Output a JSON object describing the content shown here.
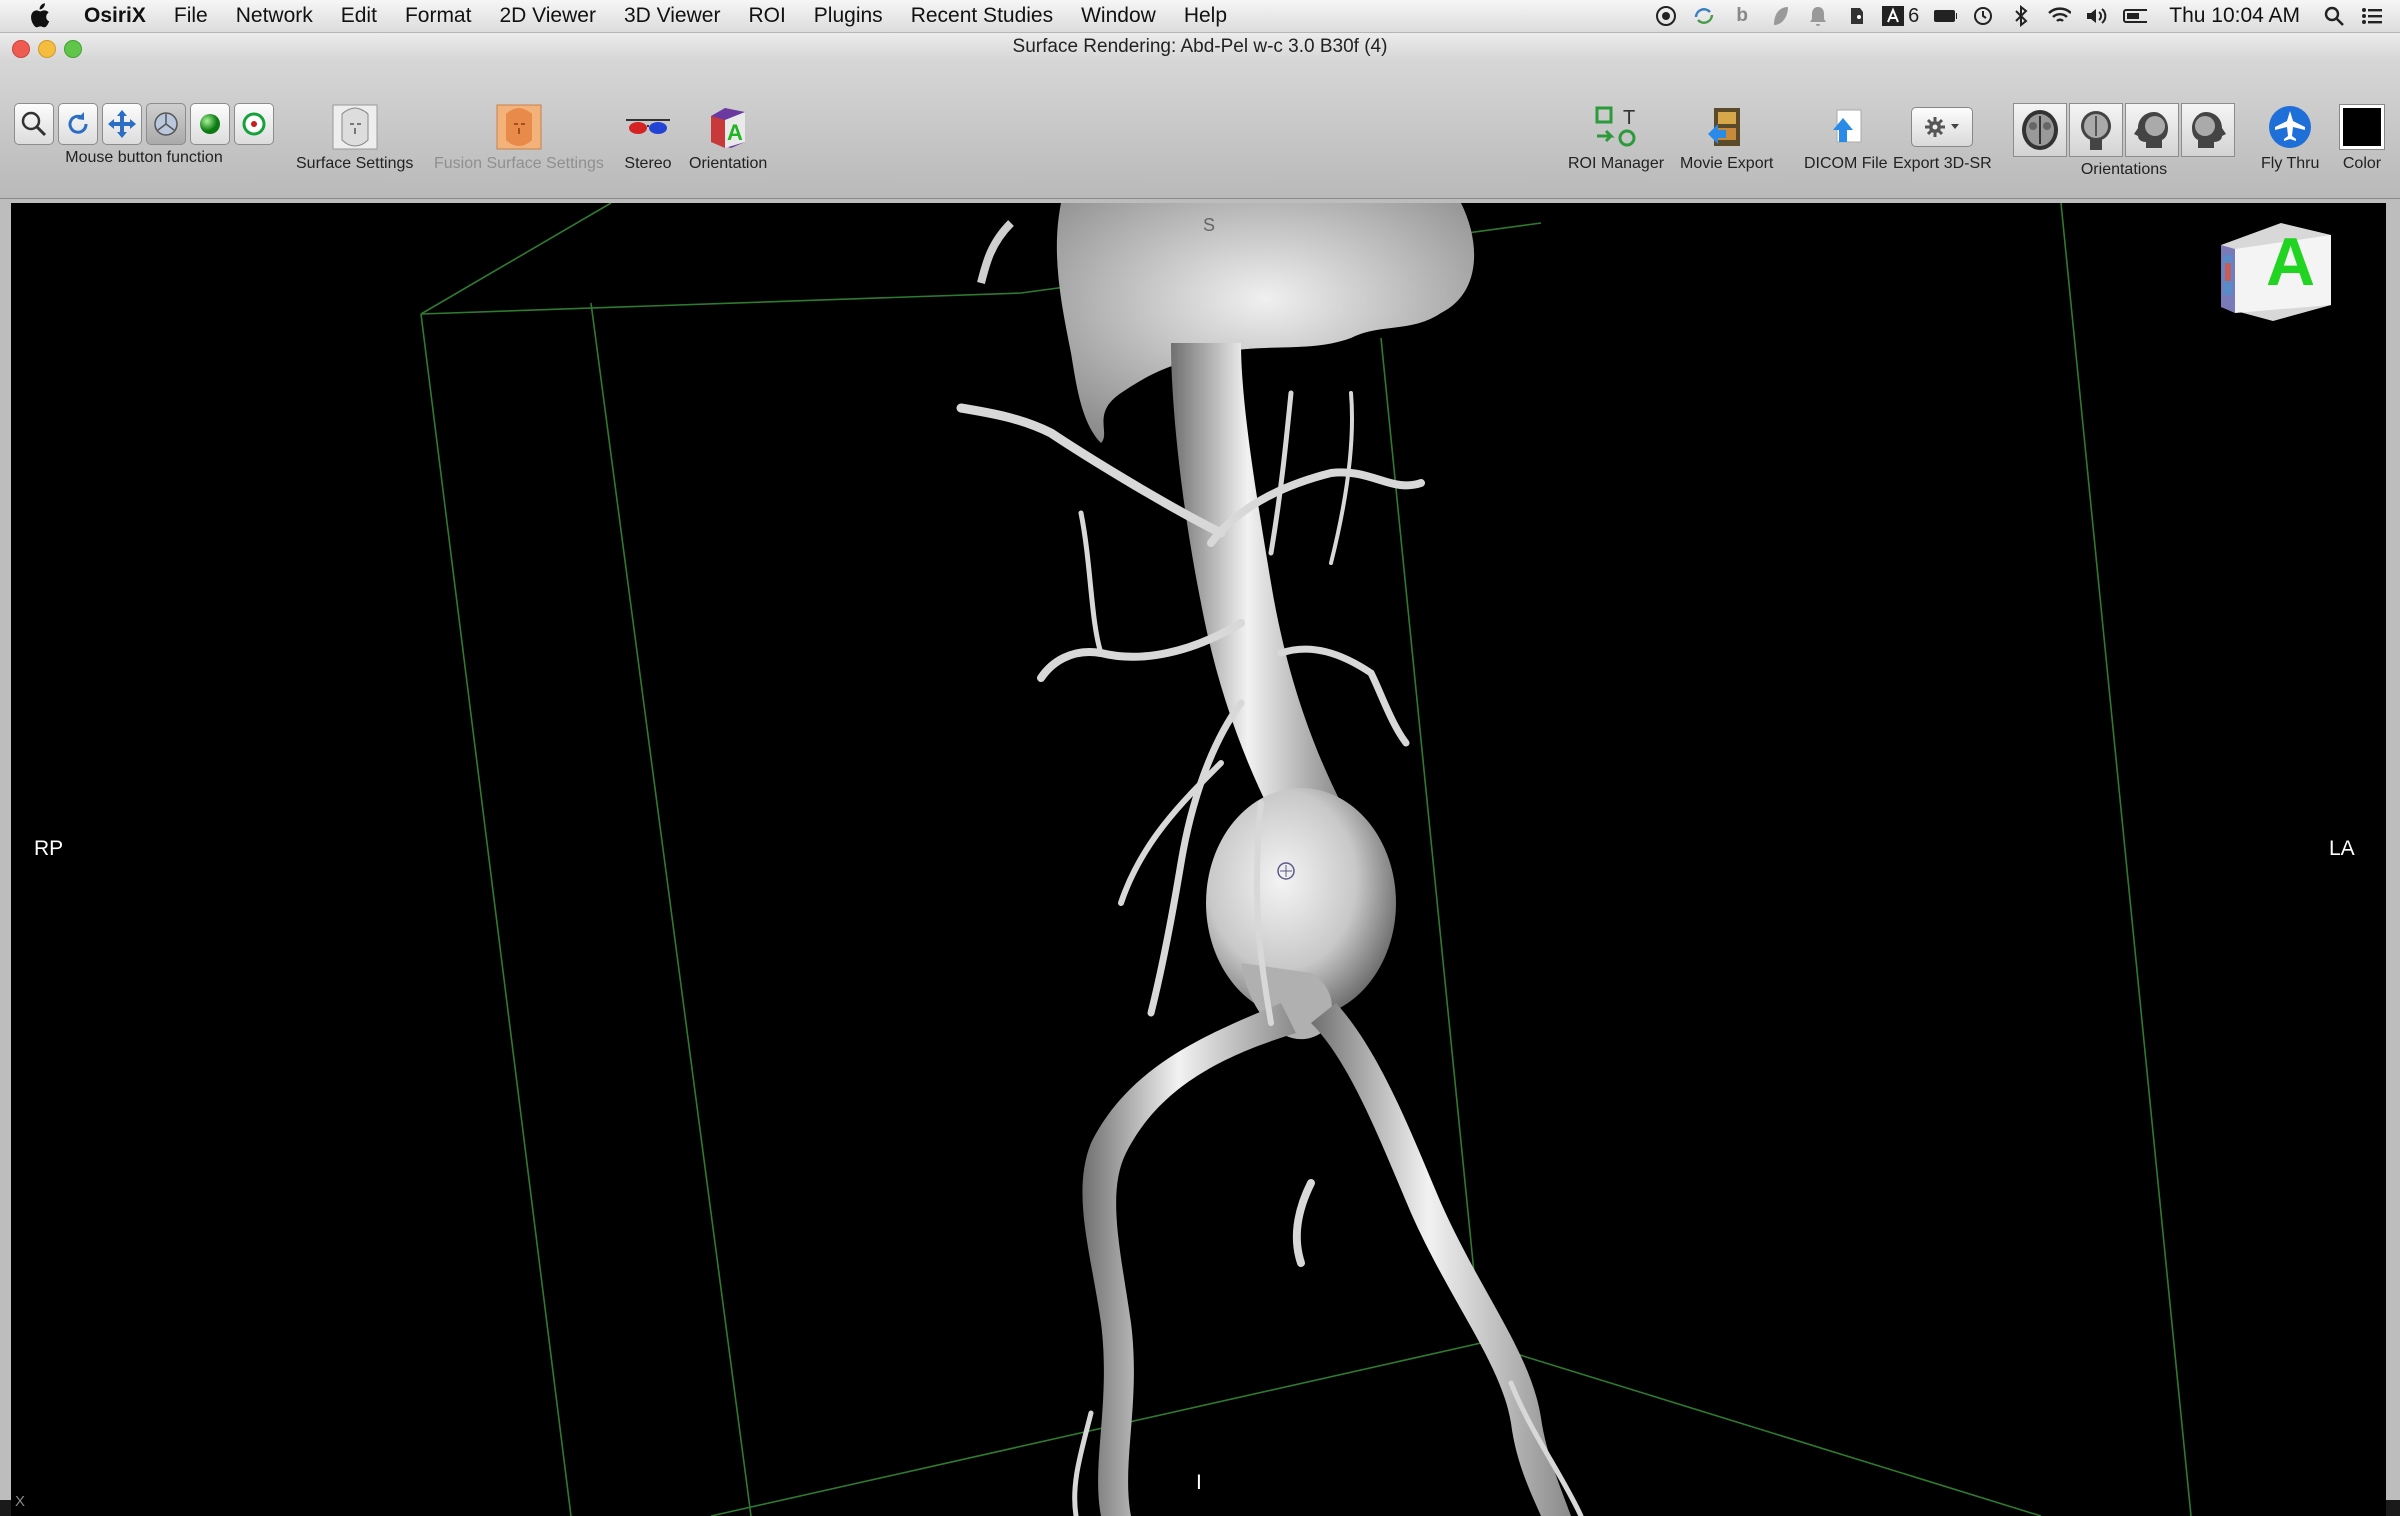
{
  "menubar": {
    "app_name": "OsiriX",
    "items": [
      "File",
      "Network",
      "Edit",
      "Format",
      "2D Viewer",
      "3D Viewer",
      "ROI",
      "Plugins",
      "Recent Studies",
      "Window",
      "Help"
    ],
    "status_badge_count": "6",
    "clock": "Thu 10:04 AM"
  },
  "window": {
    "title": "Surface Rendering: Abd-Pel w-c 3.0 B30f (4)"
  },
  "toolbar": {
    "mouse_function_label": "Mouse button function",
    "surface_settings_label": "Surface Settings",
    "fusion_surface_settings_label": "Fusion Surface Settings",
    "stereo_label": "Stereo",
    "orientation_label": "Orientation",
    "roi_manager_label": "ROI Manager",
    "movie_export_label": "Movie Export",
    "dicom_file_label": "DICOM File",
    "export_3dsr_label": "Export 3D-SR",
    "orientations_label": "Orientations",
    "fly_thru_label": "Fly Thru",
    "color_label": "Color"
  },
  "viewport": {
    "left_label": "RP",
    "right_label": "LA",
    "bottom_label": "I",
    "top_marker": "S",
    "corner_marker": "X",
    "orientation_cube_letter": "A"
  },
  "colors": {
    "viewport_background": "#000000",
    "bounding_box": "#2f7a2f",
    "cube_letter": "#22d422"
  }
}
